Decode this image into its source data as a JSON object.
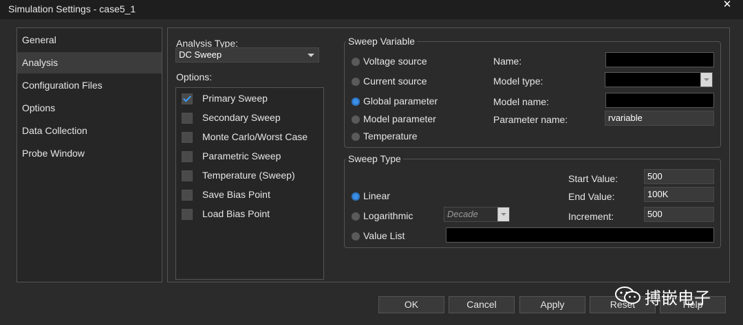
{
  "window": {
    "title": "Simulation Settings - case5_1"
  },
  "nav": {
    "items": [
      {
        "label": "General"
      },
      {
        "label": "Analysis"
      },
      {
        "label": "Configuration Files"
      },
      {
        "label": "Options"
      },
      {
        "label": "Data Collection"
      },
      {
        "label": "Probe Window"
      }
    ],
    "selected": "Analysis"
  },
  "analysis": {
    "type_label": "Analysis Type:",
    "type_value": "DC Sweep",
    "options_label": "Options:",
    "options": [
      {
        "label": "Primary Sweep",
        "checked": true
      },
      {
        "label": "Secondary Sweep",
        "checked": false
      },
      {
        "label": "Monte Carlo/Worst Case",
        "checked": false
      },
      {
        "label": "Parametric Sweep",
        "checked": false
      },
      {
        "label": "Temperature (Sweep)",
        "checked": false
      },
      {
        "label": "Save Bias Point",
        "checked": false
      },
      {
        "label": "Load Bias Point",
        "checked": false
      }
    ]
  },
  "sweep_variable": {
    "title": "Sweep Variable",
    "radios": [
      {
        "label": "Voltage source",
        "selected": false
      },
      {
        "label": "Current source",
        "selected": false
      },
      {
        "label": "Global parameter",
        "selected": true
      },
      {
        "label": "Model parameter",
        "selected": false
      },
      {
        "label": "Temperature",
        "selected": false
      }
    ],
    "fields": {
      "name_label": "Name:",
      "name_value": "",
      "model_type_label": "Model type:",
      "model_type_value": "",
      "model_name_label": "Model name:",
      "model_name_value": "",
      "parameter_name_label": "Parameter name:",
      "parameter_name_value": "rvariable"
    }
  },
  "sweep_type": {
    "title": "Sweep Type",
    "radios": [
      {
        "label": "Linear",
        "selected": true
      },
      {
        "label": "Logarithmic",
        "selected": false
      },
      {
        "label": "Value List",
        "selected": false
      }
    ],
    "log_scale_value": "Decade",
    "value_list_value": "",
    "start_label": "Start Value:",
    "start_value": "500",
    "end_label": "End Value:",
    "end_value": "100K",
    "increment_label": "Increment:",
    "increment_value": "500"
  },
  "buttons": {
    "ok": "OK",
    "cancel": "Cancel",
    "apply": "Apply",
    "reset": "Reset",
    "help": "Help"
  },
  "watermark": {
    "text": "搏嵌电子"
  },
  "colors": {
    "accent": "#3b8fe6",
    "window_bg": "#2b2b2b",
    "field_bg": "#000000"
  }
}
